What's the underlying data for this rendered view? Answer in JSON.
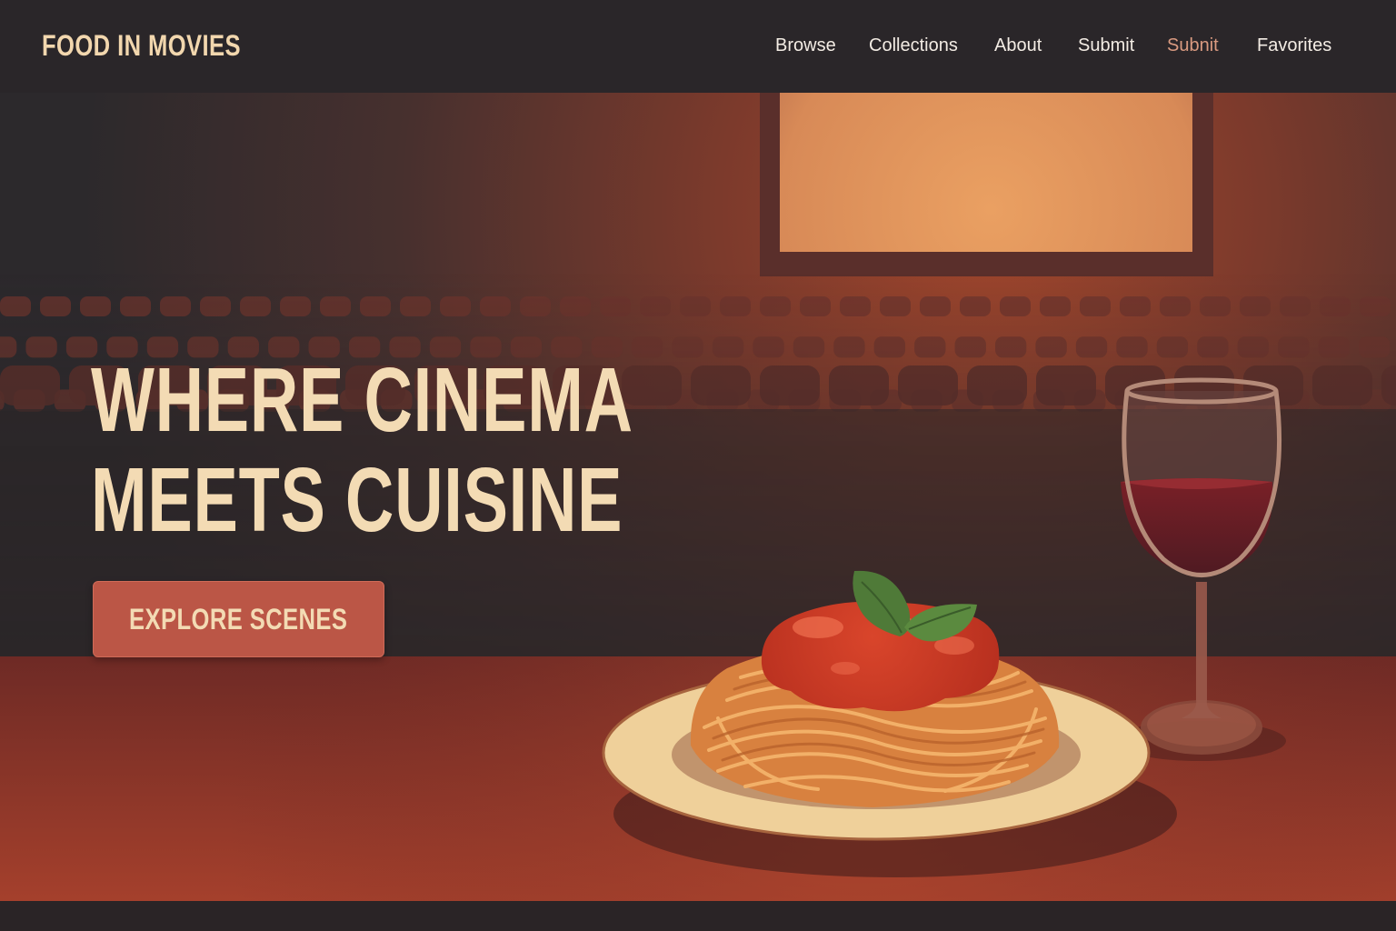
{
  "brand": {
    "name": "FOOD IN MOVIES"
  },
  "nav": {
    "items": [
      {
        "label": "Browse"
      },
      {
        "label": "Collections"
      },
      {
        "label": "About"
      },
      {
        "label": "Submit"
      },
      {
        "label": "Subnit",
        "active": true
      },
      {
        "label": "Favorites"
      }
    ]
  },
  "hero": {
    "title_line1": "WHERE CINEMA",
    "title_line2": "MEETS CUISINE",
    "cta_label": "EXPLORE SCENES"
  },
  "colors": {
    "nav_background": "#2a2629",
    "nav_text": "#f3ece4",
    "nav_active": "#d99a80",
    "brand_text": "#f2d7ae",
    "headline": "#f3dbb4",
    "cta_background": "#bb5646"
  }
}
